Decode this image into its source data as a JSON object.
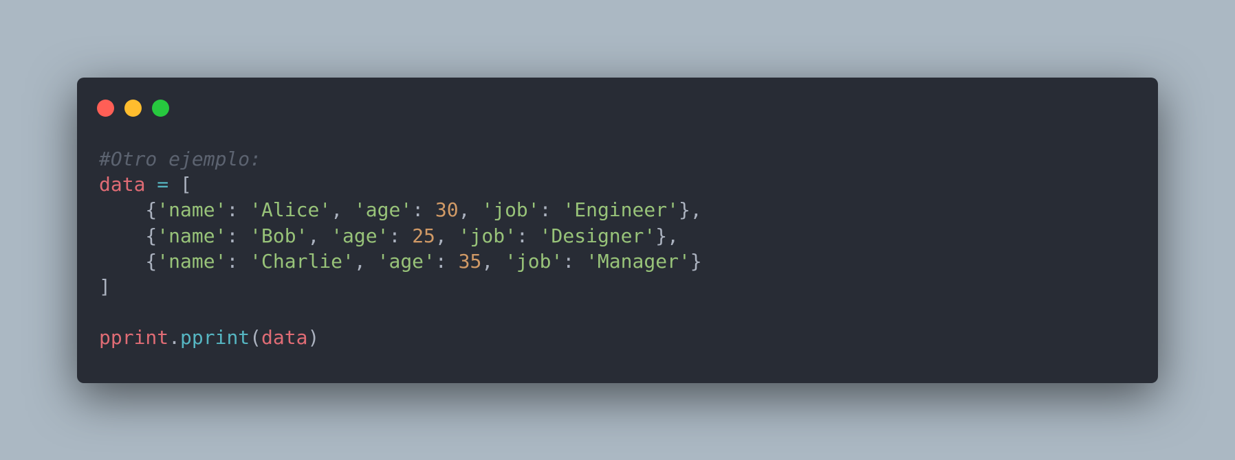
{
  "colors": {
    "background": "#abb8c3",
    "window": "#282c35",
    "close": "#ff5f56",
    "minimize": "#ffbd2e",
    "maximize": "#27c93f"
  },
  "window_controls": [
    {
      "name": "close-control-icon"
    },
    {
      "name": "minimize-control-icon"
    },
    {
      "name": "maximize-control-icon"
    }
  ],
  "code": {
    "lines": [
      [
        {
          "t": "#Otro ejemplo:",
          "c": "comment"
        }
      ],
      [
        {
          "t": "data",
          "c": "var"
        },
        {
          "t": " ",
          "c": "punc"
        },
        {
          "t": "=",
          "c": "op"
        },
        {
          "t": " [",
          "c": "punc"
        }
      ],
      [
        {
          "t": "    {",
          "c": "punc"
        },
        {
          "t": "'name'",
          "c": "str"
        },
        {
          "t": ": ",
          "c": "punc"
        },
        {
          "t": "'Alice'",
          "c": "str"
        },
        {
          "t": ", ",
          "c": "punc"
        },
        {
          "t": "'age'",
          "c": "str"
        },
        {
          "t": ": ",
          "c": "punc"
        },
        {
          "t": "30",
          "c": "num"
        },
        {
          "t": ", ",
          "c": "punc"
        },
        {
          "t": "'job'",
          "c": "str"
        },
        {
          "t": ": ",
          "c": "punc"
        },
        {
          "t": "'Engineer'",
          "c": "str"
        },
        {
          "t": "},",
          "c": "punc"
        }
      ],
      [
        {
          "t": "    {",
          "c": "punc"
        },
        {
          "t": "'name'",
          "c": "str"
        },
        {
          "t": ": ",
          "c": "punc"
        },
        {
          "t": "'Bob'",
          "c": "str"
        },
        {
          "t": ", ",
          "c": "punc"
        },
        {
          "t": "'age'",
          "c": "str"
        },
        {
          "t": ": ",
          "c": "punc"
        },
        {
          "t": "25",
          "c": "num"
        },
        {
          "t": ", ",
          "c": "punc"
        },
        {
          "t": "'job'",
          "c": "str"
        },
        {
          "t": ": ",
          "c": "punc"
        },
        {
          "t": "'Designer'",
          "c": "str"
        },
        {
          "t": "},",
          "c": "punc"
        }
      ],
      [
        {
          "t": "    {",
          "c": "punc"
        },
        {
          "t": "'name'",
          "c": "str"
        },
        {
          "t": ": ",
          "c": "punc"
        },
        {
          "t": "'Charlie'",
          "c": "str"
        },
        {
          "t": ", ",
          "c": "punc"
        },
        {
          "t": "'age'",
          "c": "str"
        },
        {
          "t": ": ",
          "c": "punc"
        },
        {
          "t": "35",
          "c": "num"
        },
        {
          "t": ", ",
          "c": "punc"
        },
        {
          "t": "'job'",
          "c": "str"
        },
        {
          "t": ": ",
          "c": "punc"
        },
        {
          "t": "'Manager'",
          "c": "str"
        },
        {
          "t": "}",
          "c": "punc"
        }
      ],
      [
        {
          "t": "]",
          "c": "punc"
        }
      ],
      [],
      [
        {
          "t": "pprint",
          "c": "var"
        },
        {
          "t": ".",
          "c": "punc"
        },
        {
          "t": "pprint",
          "c": "fn"
        },
        {
          "t": "(",
          "c": "punc"
        },
        {
          "t": "data",
          "c": "var"
        },
        {
          "t": ")",
          "c": "punc"
        }
      ]
    ]
  }
}
